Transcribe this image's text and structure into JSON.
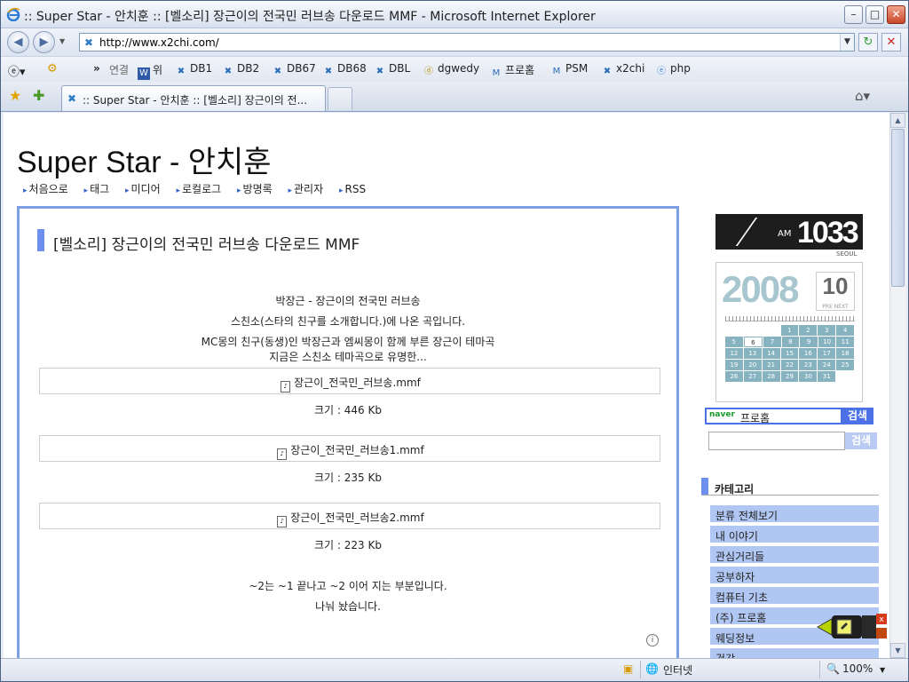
{
  "window": {
    "title": ":: Super Star - 안치훈 :: [벨소리] 장근이의 전국민 러브송 다운로드 MMF - Microsoft Internet Explorer"
  },
  "address": {
    "url": "http://www.x2chi.com/"
  },
  "links_bar": {
    "chevron": "»",
    "label": "연결",
    "items": [
      "위",
      "DB1",
      "DB2",
      "DB67",
      "DB68",
      "DBL",
      "dgwedy",
      "프로홈",
      "PSM",
      "x2chi",
      "php"
    ]
  },
  "tab": {
    "title": ":: Super Star - 안치훈 :: [벨소리] 장근이의 전..."
  },
  "blog": {
    "title_en": "Super Star - ",
    "title_ko": "안치훈",
    "menu": [
      "처음으로",
      "태그",
      "미디어",
      "로컬로그",
      "방명록",
      "관리자",
      "RSS"
    ]
  },
  "post": {
    "heading": "[벨소리] 장근이의 전국민 러브송 다운로드 MMF",
    "lines": [
      "박장근 - 장근이의 전국민 러브송",
      "스친소(스타의 친구를 소개합니다.)에 나온 곡입니다.",
      "MC몽의 친구(동생)인 박장근과 엠씨몽이 함께 부른 장근이 테마곡",
      "지금은 스친소 테마곡으로 유명한..."
    ],
    "files": [
      {
        "name": "장근이_전국민_러브송.mmf",
        "size": "크기 : 446 Kb"
      },
      {
        "name": "장근이_전국민_러브송1.mmf",
        "size": "크기 : 235 Kb"
      },
      {
        "name": "장근이_전국민_러브송2.mmf",
        "size": "크기 : 223 Kb"
      }
    ],
    "footer_lines": [
      "~2는 ~1 끝나고 ~2 이어 지는 부분입니다.",
      "나눠 놨습니다."
    ]
  },
  "sidebar": {
    "clock": {
      "ampm": "AM",
      "time": "1033",
      "city": "SEOUL"
    },
    "calendar": {
      "year": "2008",
      "month": "10",
      "nav": "PRE  NEXT",
      "weeks": [
        [
          "",
          "",
          "",
          "1",
          "2",
          "3",
          "4"
        ],
        [
          "5",
          "6",
          "7",
          "8",
          "9",
          "10",
          "11"
        ],
        [
          "12",
          "13",
          "14",
          "15",
          "16",
          "17",
          "18"
        ],
        [
          "19",
          "20",
          "21",
          "22",
          "23",
          "24",
          "25"
        ],
        [
          "26",
          "27",
          "28",
          "29",
          "30",
          "31",
          ""
        ]
      ],
      "today": "6"
    },
    "search_naver": {
      "engine": "naver",
      "value": "프로홈",
      "button": "검색"
    },
    "search_blog": {
      "value": "",
      "button": "검색"
    },
    "category_title": "카테고리",
    "categories": [
      "분류 전체보기",
      "내 이야기",
      "관심거리들",
      "공부하자",
      "컴퓨터 기초",
      "(주) 프로홈",
      "웨딩정보",
      "건강"
    ]
  },
  "status": {
    "zone": "인터넷",
    "zoom": "100%"
  },
  "colors": {
    "accent": "#6d8ff0",
    "post_border": "#7c9fe6",
    "category_bg": "#b1c7f3",
    "search_btn": "#4c71e6"
  }
}
